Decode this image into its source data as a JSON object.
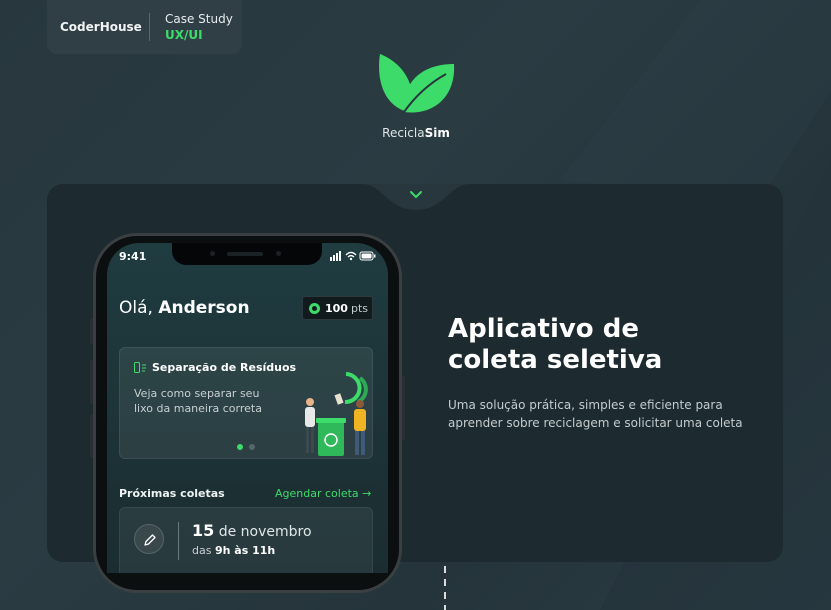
{
  "badge": {
    "brand": "CoderHouse",
    "case_study": "Case Study",
    "tag": "UX/UI"
  },
  "logo": {
    "prefix": "Recicla",
    "suffix": "Sim",
    "icon": "leaves-logo-icon"
  },
  "phone": {
    "time": "9:41",
    "greeting_prefix": "Olá, ",
    "greeting_name": "Anderson",
    "points_value": "100",
    "points_unit": "pts",
    "card": {
      "title": "Separação de Resíduos",
      "description": "Veja como separar seu lixo da maneira correta",
      "icon": "waste-separation-icon"
    },
    "upcoming_label": "Próximas coletas",
    "schedule_link": "Agendar coleta →",
    "next_collection": {
      "day": "15",
      "month": " de novembro",
      "hours_prefix": "das ",
      "hours": "9h às 11h",
      "icon": "pencil-icon"
    }
  },
  "hero": {
    "title": "Aplicativo de coleta seletiva",
    "description": "Uma solução prática, simples e eficiente para aprender sobre reciclagem e solicitar uma coleta"
  },
  "colors": {
    "accent": "#3ddc6a",
    "background": "#27373d",
    "card": "#1d2a2f"
  }
}
